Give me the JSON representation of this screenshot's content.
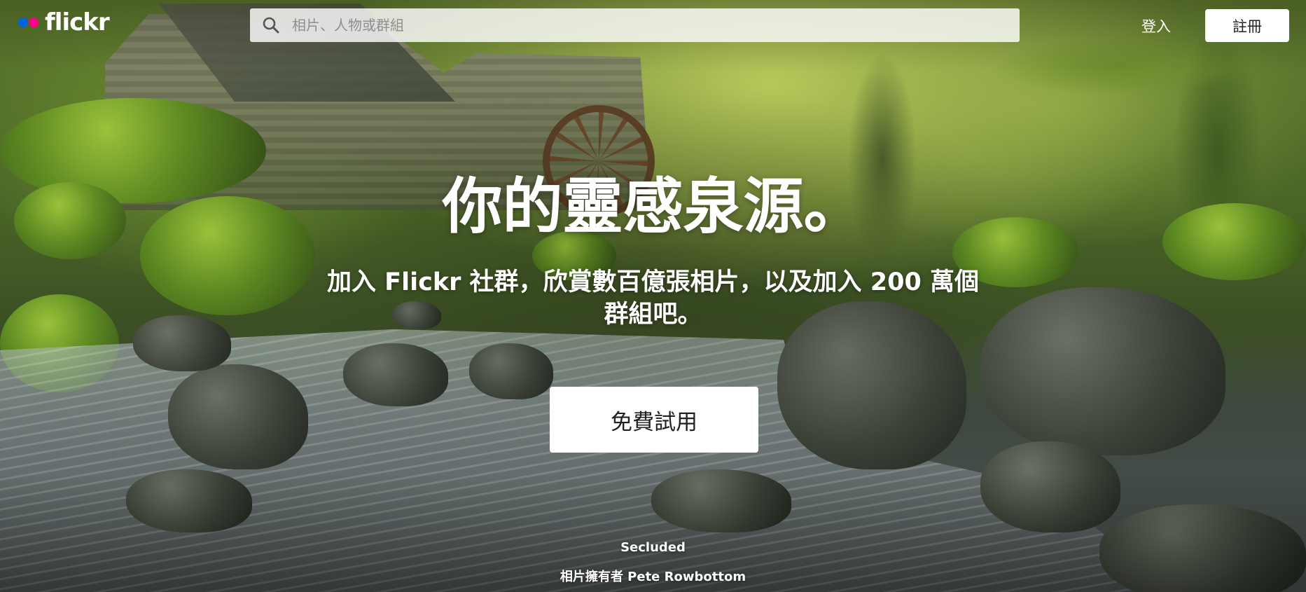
{
  "brand": {
    "name": "flickr",
    "colors": {
      "blue": "#0063dc",
      "pink": "#ff0084"
    }
  },
  "header": {
    "search": {
      "placeholder": "相片、人物或群組",
      "value": "",
      "icon": "search-icon"
    },
    "login_label": "登入",
    "signup_label": "註冊"
  },
  "hero": {
    "title": "你的靈感泉源。",
    "subtitle": "加入 Flickr 社群，欣賞數百億張相片，以及加入 200 萬個群組吧。",
    "cta_label": "免費試用"
  },
  "photo_credit": {
    "title": "Secluded",
    "owner_prefix": "相片擁有者",
    "owner_name": "Pete Rowbottom"
  }
}
